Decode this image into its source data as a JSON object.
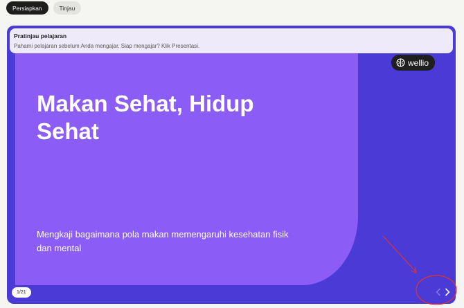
{
  "tabs": [
    {
      "label": "Persiapkan",
      "active": true
    },
    {
      "label": "Tinjau",
      "active": false
    }
  ],
  "banner": {
    "title": "Pratinjau pelajaran",
    "description": "Pahami pelajaran sebelum Anda mengajar. Siap mengajar? Klik Presentasi."
  },
  "slide": {
    "title": "Makan Sehat, Hidup Sehat",
    "subtitle": "Mengkaji bagaimana pola makan memengaruhi kesehatan fisik dan mental",
    "page_indicator": "1/21"
  },
  "brand": {
    "name": "wellio",
    "icon": "brain-icon"
  },
  "controls": {
    "prev_icon": "chevron-left-icon",
    "next_icon": "chevron-right-icon"
  },
  "colors": {
    "frame": "#4a3ad6",
    "slide_panel": "#8b5cf6",
    "banner": "#efeaf9",
    "annotation": "#e0332b"
  }
}
